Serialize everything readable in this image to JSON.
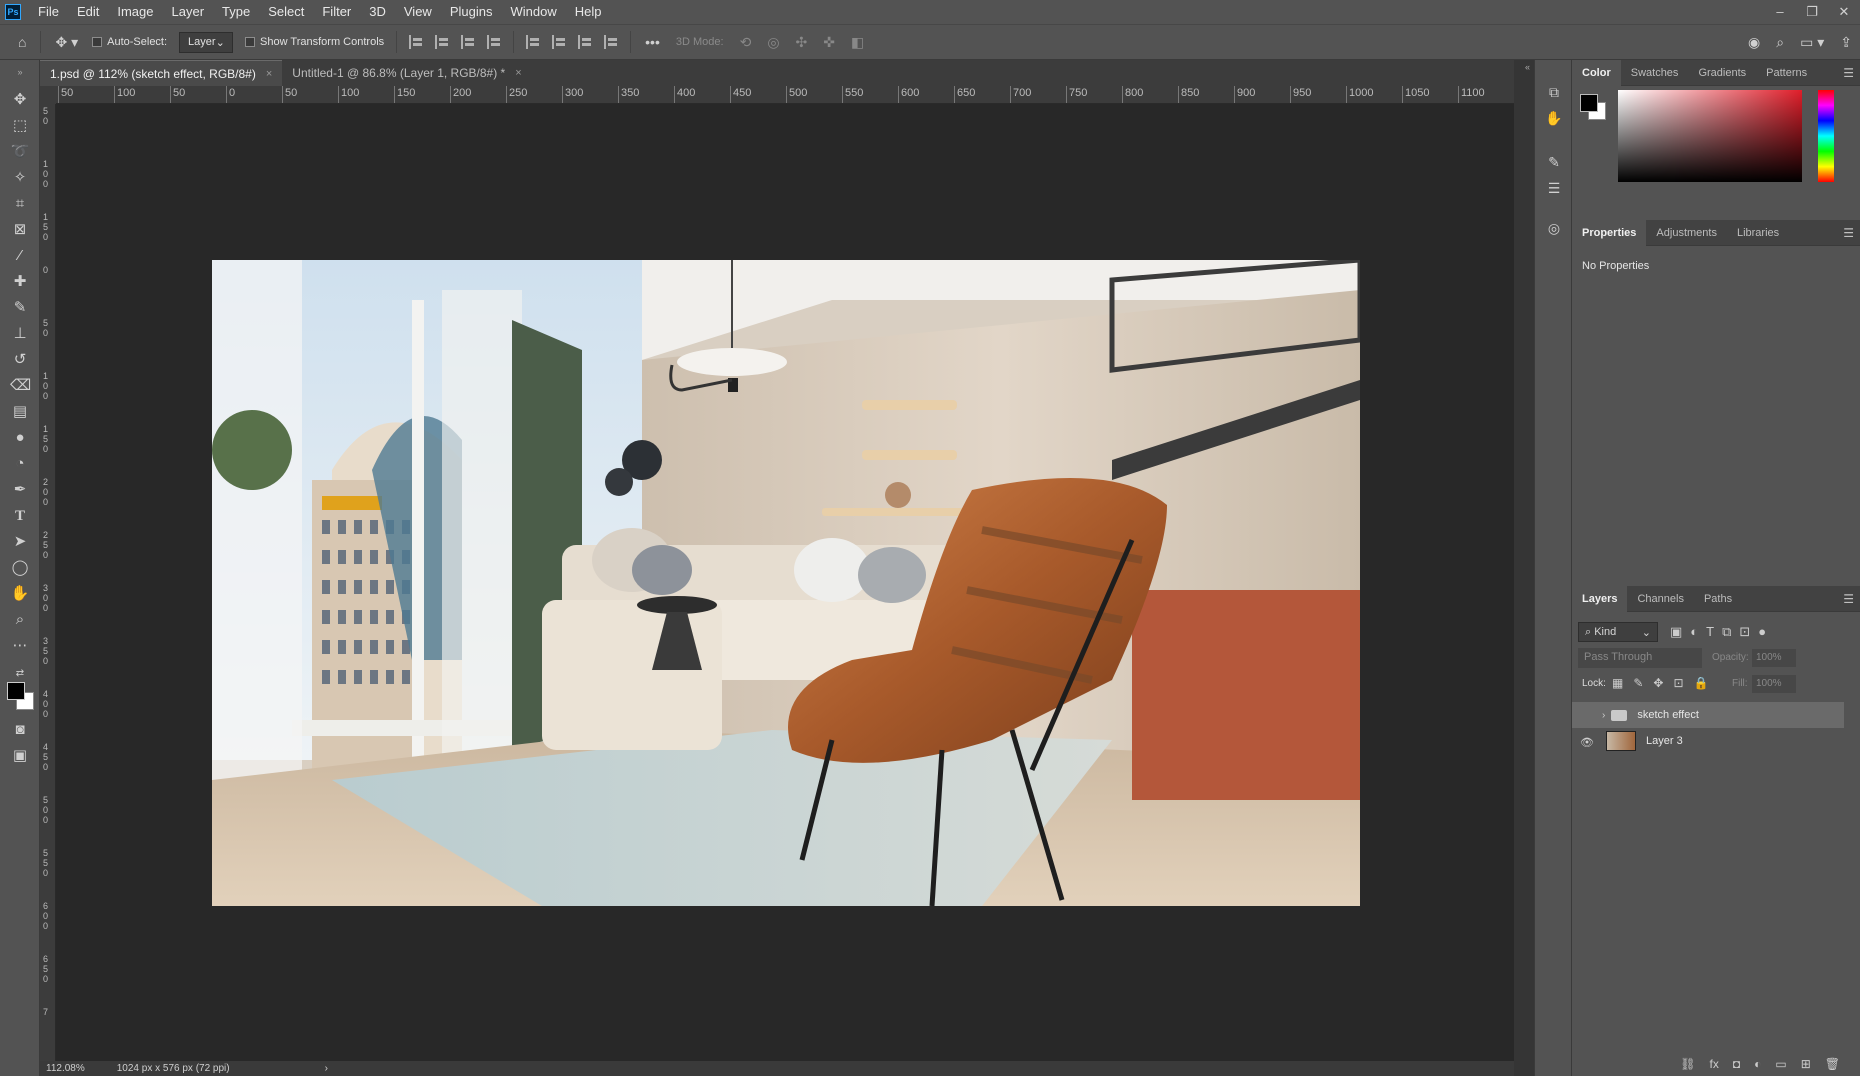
{
  "app": {
    "logo": "Ps"
  },
  "menu": [
    "File",
    "Edit",
    "Image",
    "Layer",
    "Type",
    "Select",
    "Filter",
    "3D",
    "View",
    "Plugins",
    "Window",
    "Help"
  ],
  "window_controls": {
    "minimize": "–",
    "restore": "❐",
    "close": "✕"
  },
  "options": {
    "auto_select_label": "Auto-Select:",
    "auto_select_value": "Layer",
    "show_transform_label": "Show Transform Controls",
    "more": "•••",
    "mode_3d_label": "3D Mode:"
  },
  "tabs": [
    {
      "label": "1.psd @ 112% (sketch effect, RGB/8#)",
      "active": true
    },
    {
      "label": "Untitled-1 @ 86.8% (Layer 1, RGB/8#) *",
      "active": false
    }
  ],
  "ruler_h_labels": [
    "50",
    "100",
    "50",
    "0",
    "50",
    "100",
    "150",
    "200",
    "250",
    "300",
    "350",
    "400",
    "450",
    "500",
    "550",
    "600",
    "650",
    "700",
    "750",
    "800",
    "850",
    "900",
    "950",
    "1000",
    "1050",
    "1100",
    "11"
  ],
  "ruler_v_labels": [
    "5\n0",
    "1\n0\n0",
    "1\n5\n0",
    "0",
    "5\n0",
    "1\n0\n0",
    "1\n5\n0",
    "2\n0\n0",
    "2\n5\n0",
    "3\n0\n0",
    "3\n5\n0",
    "4\n0\n0",
    "4\n5\n0",
    "5\n0\n0",
    "5\n5\n0",
    "6\n0\n0",
    "6\n5\n0",
    "7"
  ],
  "status": {
    "zoom": "112.08%",
    "doc_info": "1024 px x 576 px (72 ppi)",
    "arrow": "›"
  },
  "color_panel": {
    "tabs": [
      "Color",
      "Swatches",
      "Gradients",
      "Patterns"
    ],
    "foreground": "#000000",
    "background": "#ffffff",
    "hue": "#e01e2a"
  },
  "properties_panel": {
    "tabs": [
      "Properties",
      "Adjustments",
      "Libraries"
    ],
    "empty_text": "No Properties"
  },
  "layers_panel": {
    "tabs": [
      "Layers",
      "Channels",
      "Paths"
    ],
    "kind_label": "Kind",
    "blend_mode": "Pass Through",
    "opacity_label": "Opacity:",
    "opacity_value": "100%",
    "lock_label": "Lock:",
    "fill_label": "Fill:",
    "fill_value": "100%",
    "layers": [
      {
        "name": "sketch effect",
        "type": "group",
        "visible": false,
        "selected": true
      },
      {
        "name": "Layer 3",
        "type": "pixel",
        "visible": true,
        "selected": false
      }
    ],
    "footer_icons": [
      "link-icon",
      "fx-icon",
      "mask-icon",
      "adjustment-icon",
      "folder-icon",
      "new-layer-icon",
      "trash-icon"
    ]
  },
  "colors": {
    "ui_bg": "#535353",
    "canvas_bg": "#282828",
    "accent": "#31a8ff"
  }
}
